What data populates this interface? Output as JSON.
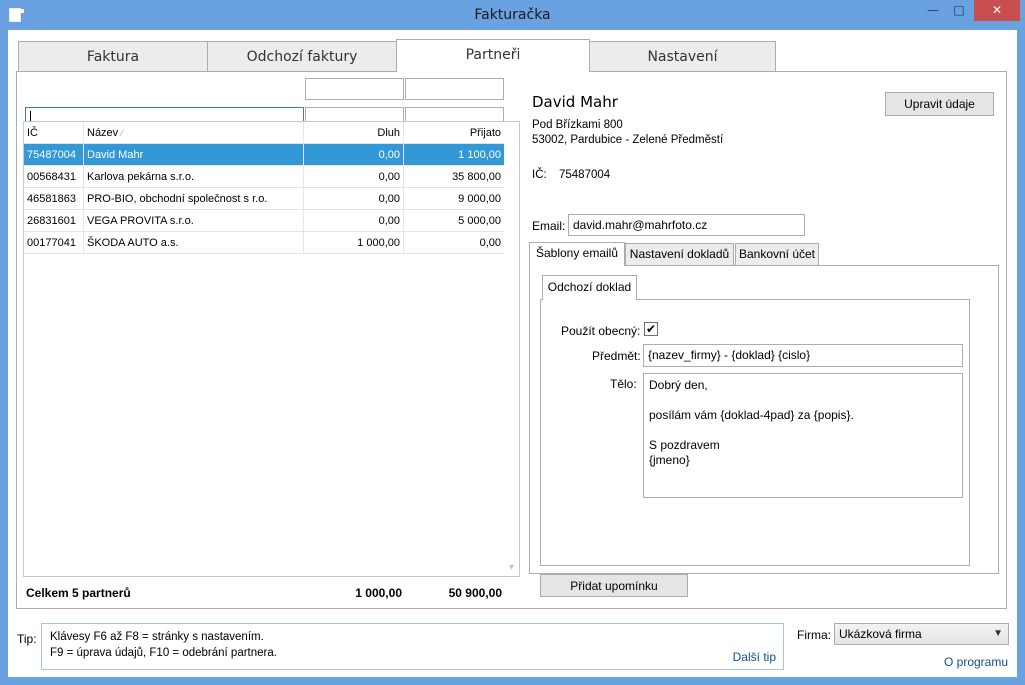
{
  "window": {
    "title": "Fakturačka",
    "min_glyph": "—",
    "max_glyph": "□",
    "close_glyph": "✕"
  },
  "tabs": [
    {
      "label": "Faktura",
      "active": false
    },
    {
      "label": "Odchozí faktury",
      "active": false
    },
    {
      "label": "Partneři",
      "active": true
    },
    {
      "label": "Nastavení",
      "active": false
    }
  ],
  "partners_grid": {
    "filter_value": "",
    "columns": {
      "ic": "IČ",
      "nazev": "Název",
      "sort_glyph": "⁄",
      "dluh": "Dluh",
      "prijato": "Přijato"
    },
    "rows": [
      {
        "ic": "75487004",
        "nazev": "David Mahr",
        "dluh": "0,00",
        "prijato": "1 100,00",
        "selected": true
      },
      {
        "ic": "00568431",
        "nazev": "Karlova pekárna s.r.o.",
        "dluh": "0,00",
        "prijato": "35 800,00",
        "selected": false
      },
      {
        "ic": "46581863",
        "nazev": "PRO-BIO, obchodní společnost s r.o.",
        "dluh": "0,00",
        "prijato": "9 000,00",
        "selected": false
      },
      {
        "ic": "26831601",
        "nazev": "VEGA PROVITA s.r.o.",
        "dluh": "0,00",
        "prijato": "5 000,00",
        "selected": false
      },
      {
        "ic": "00177041",
        "nazev": "ŠKODA AUTO a.s.",
        "dluh": "1 000,00",
        "prijato": "0,00",
        "selected": false
      }
    ],
    "totals": {
      "label": "Celkem 5 partnerů",
      "dluh": "1 000,00",
      "prijato": "50 900,00"
    }
  },
  "detail": {
    "name": "David Mahr",
    "street": "Pod Břízkami 800",
    "city": "53002, Pardubice - Zelené Předměstí",
    "ic_label": "IČ:",
    "ic_value": "75487004",
    "edit_button": "Upravit údaje",
    "email_label": "Email:",
    "email_value": "david.mahr@mahrfoto.cz",
    "subtabs": [
      {
        "label": "Šablony emailů",
        "active": true
      },
      {
        "label": "Nastavení dokladů",
        "active": false
      },
      {
        "label": "Bankovní účet",
        "active": false
      }
    ],
    "inner_tab": "Odchozí doklad",
    "use_general_label": "Použít obecný:",
    "use_general_checked": true,
    "check_glyph": "✔",
    "subject_label": "Předmět:",
    "subject_value": "{nazev_firmy} - {doklad} {cislo}",
    "body_label": "Tělo:",
    "body_lines": [
      "Dobrý den,",
      "",
      "posílám vám {doklad-4pad} za {popis}.",
      "",
      "S pozdravem",
      "{jmeno}"
    ],
    "add_reminder_button": "Přidat upomínku"
  },
  "footer": {
    "tip_label": "Tip:",
    "tip_line1": "Klávesy F6 až F8 = stránky s nastavením.",
    "tip_line2": "F9 = úprava údajů, F10 = odebrání partnera.",
    "next_tip": "Další tip",
    "firma_label": "Firma:",
    "firma_value": "Ukázková firma",
    "about": "O programu"
  },
  "colors": {
    "selection": "#3399d6",
    "window_frame": "#6aa1e0",
    "close_button": "#c7504e",
    "link": "#0f4e8f"
  }
}
